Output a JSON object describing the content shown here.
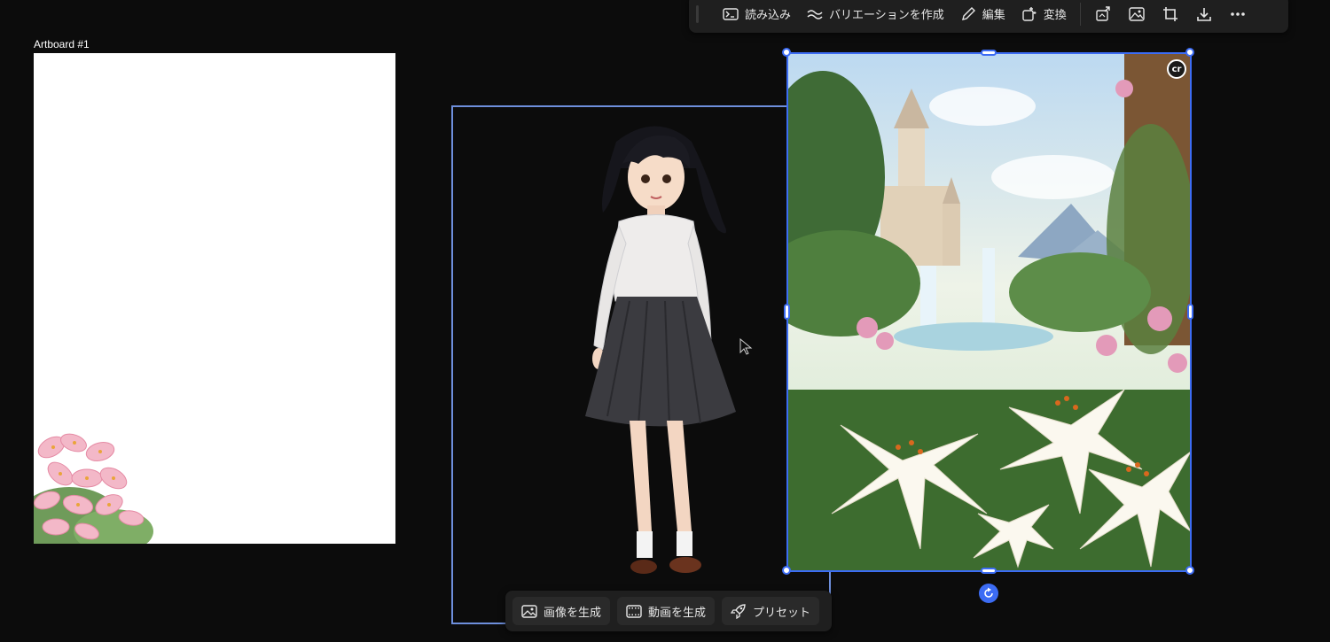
{
  "artboard": {
    "label": "Artboard #1"
  },
  "top_toolbar": {
    "import_label": "読み込み",
    "variation_label": "バリエーションを作成",
    "edit_label": "編集",
    "transform_label": "変換",
    "icons": [
      "export-layer-icon",
      "image-icon",
      "crop-icon",
      "download-icon",
      "more-icon"
    ]
  },
  "bottom_toolbar": {
    "generate_image_label": "画像を生成",
    "generate_video_label": "動画を生成",
    "preset_label": "プリセット"
  },
  "badge": {
    "label": "cr"
  },
  "colors": {
    "selection": "#3c6cf4",
    "frame": "#6e8fdc",
    "background": "#0c0c0c",
    "toolbar": "#1f1f1f"
  }
}
